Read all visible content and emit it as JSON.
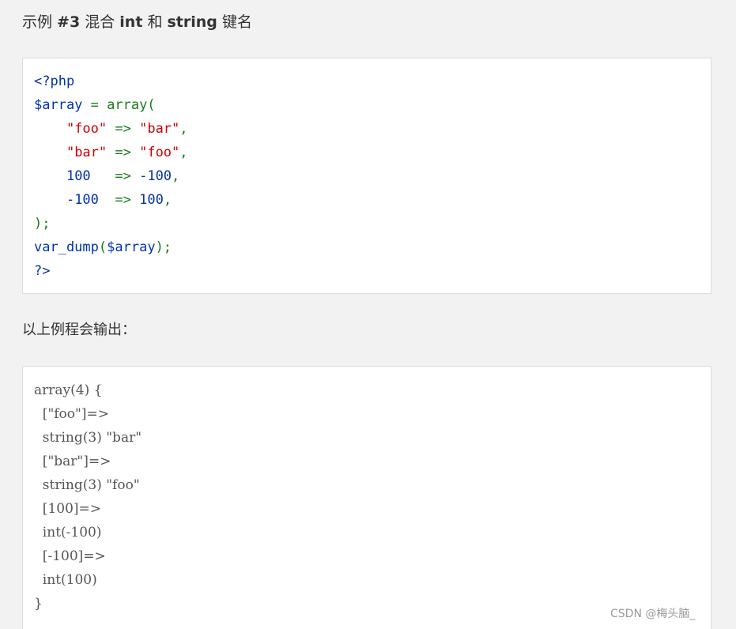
{
  "heading": {
    "prefix": "示例 ",
    "example_number": "#3",
    "mid1": " 混合 ",
    "type1": "int",
    "mid2": " 和 ",
    "type2": "string",
    "suffix": " 键名"
  },
  "code_lines": [
    [
      {
        "text": "<?php",
        "cls": "c-default"
      }
    ],
    [
      {
        "text": "$array",
        "cls": "c-default"
      },
      {
        "text": " = array(",
        "cls": "c-keyword"
      }
    ],
    [
      {
        "text": "    ",
        "cls": "c-keyword"
      },
      {
        "text": "\"foo\"",
        "cls": "c-string"
      },
      {
        "text": " => ",
        "cls": "c-keyword"
      },
      {
        "text": "\"bar\"",
        "cls": "c-string"
      },
      {
        "text": ",",
        "cls": "c-keyword"
      }
    ],
    [
      {
        "text": "    ",
        "cls": "c-keyword"
      },
      {
        "text": "\"bar\"",
        "cls": "c-string"
      },
      {
        "text": " => ",
        "cls": "c-keyword"
      },
      {
        "text": "\"foo\"",
        "cls": "c-string"
      },
      {
        "text": ",",
        "cls": "c-keyword"
      }
    ],
    [
      {
        "text": "    ",
        "cls": "c-keyword"
      },
      {
        "text": "100",
        "cls": "c-default"
      },
      {
        "text": "   => ",
        "cls": "c-keyword"
      },
      {
        "text": "-100",
        "cls": "c-default"
      },
      {
        "text": ",",
        "cls": "c-keyword"
      }
    ],
    [
      {
        "text": "    ",
        "cls": "c-keyword"
      },
      {
        "text": "-100",
        "cls": "c-default"
      },
      {
        "text": "  => ",
        "cls": "c-keyword"
      },
      {
        "text": "100",
        "cls": "c-default"
      },
      {
        "text": ",",
        "cls": "c-keyword"
      }
    ],
    [
      {
        "text": ");",
        "cls": "c-keyword"
      }
    ],
    [
      {
        "text": "var_dump",
        "cls": "c-default"
      },
      {
        "text": "(",
        "cls": "c-keyword"
      },
      {
        "text": "$array",
        "cls": "c-default"
      },
      {
        "text": ");",
        "cls": "c-keyword"
      }
    ],
    [
      {
        "text": "?>",
        "cls": "c-default"
      }
    ]
  ],
  "output_label": "以上例程会输出：",
  "output_lines": [
    "array(4) {",
    "  [\"foo\"]=>",
    "  string(3) \"bar\"",
    "  [\"bar\"]=>",
    "  string(3) \"foo\"",
    "  [100]=>",
    "  int(-100)",
    "  [-100]=>",
    "  int(100)",
    "}"
  ],
  "watermark": "CSDN @梅头脑_",
  "colors": {
    "page_background": "#f2f2f2",
    "code_default": "#0033aa",
    "code_keyword": "#1a7a1a",
    "code_string": "#cc0000",
    "output_text": "#555555"
  }
}
